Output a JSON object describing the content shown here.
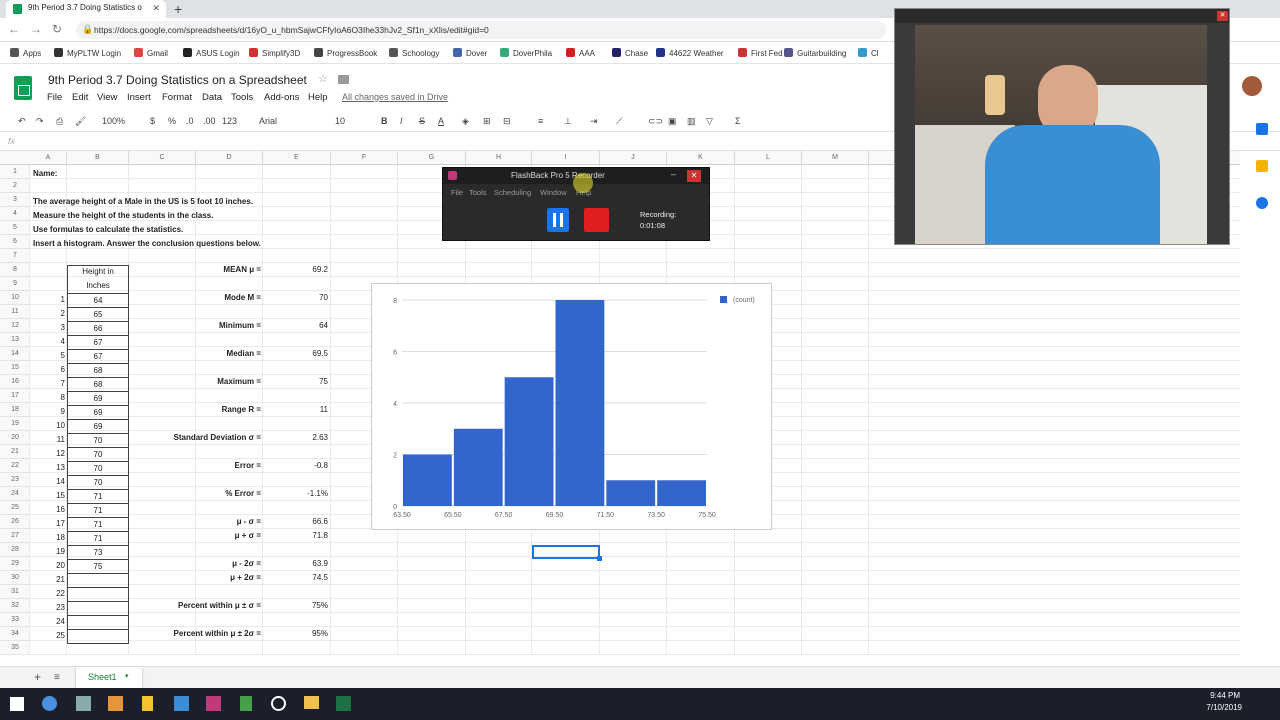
{
  "browser": {
    "tab_title": "9th Period 3.7 Doing Statistics o",
    "url": "https://docs.google.com/spreadsheets/d/16yO_u_hbmSajwCFfyIoA6O3Ihe33hJv2_Sf1n_xXlis/edit#gid=0",
    "bookmarks": [
      "Apps",
      "MyPLTW Login",
      "Gmail",
      "ASUS Login",
      "Simplify3D",
      "ProgressBook",
      "Schoology",
      "Dover",
      "DoverPhila",
      "AAA",
      "Chase",
      "44622 Weather",
      "First Fed",
      "Guitarbuilding",
      "Cl"
    ]
  },
  "doc": {
    "title": "9th Period 3.7 Doing Statistics on a Spreadsheet",
    "menus": [
      "File",
      "Edit",
      "View",
      "Insert",
      "Format",
      "Data",
      "Tools",
      "Add-ons",
      "Help"
    ],
    "saved_status": "All changes saved in Drive"
  },
  "toolbar": {
    "zoom": "100%",
    "currency": "$",
    "percent": "%",
    "dec_less": ".0",
    "dec_more": ".00",
    "format": "123",
    "font": "Arial",
    "size": "10",
    "bold": "B",
    "italic": "I",
    "strike": "S",
    "textcolor": "A",
    "sigma": "Σ"
  },
  "formula_bar": {
    "fx": "fx"
  },
  "columns": [
    "A",
    "B",
    "C",
    "D",
    "E",
    "F",
    "G",
    "H",
    "I",
    "J",
    "K",
    "L",
    "M"
  ],
  "rows": [
    "1",
    "2",
    "3",
    "4",
    "5",
    "6",
    "7",
    "8",
    "9",
    "10",
    "11",
    "12",
    "13",
    "14",
    "15",
    "16",
    "17",
    "18",
    "19",
    "20",
    "21",
    "22",
    "23",
    "24",
    "25",
    "26",
    "27",
    "28",
    "29",
    "30",
    "31",
    "32",
    "33",
    "34",
    "35"
  ],
  "text_cells": {
    "name": "Name:",
    "line1": "The average height of a Male in the US is 5 foot 10 inches.",
    "line2": "Measure the height of the students in the class.",
    "line3": "Use formulas to calculate the statistics.",
    "line4": "Insert a histogram.  Answer the conclusion questions below.",
    "height_header_1": "Height in",
    "height_header_2": "Inches"
  },
  "students": {
    "index": [
      "1",
      "2",
      "3",
      "4",
      "5",
      "6",
      "7",
      "8",
      "9",
      "10",
      "11",
      "12",
      "13",
      "14",
      "15",
      "16",
      "17",
      "18",
      "19",
      "20",
      "21",
      "22",
      "23",
      "24",
      "25"
    ],
    "heights": [
      "64",
      "65",
      "66",
      "67",
      "67",
      "68",
      "68",
      "69",
      "69",
      "69",
      "70",
      "70",
      "70",
      "70",
      "71",
      "71",
      "71",
      "71",
      "73",
      "75",
      "",
      "",
      "",
      "",
      ""
    ]
  },
  "stats": [
    {
      "label": "MEAN μ =",
      "value": "69.2"
    },
    {
      "label": "Mode M =",
      "value": "70"
    },
    {
      "label": "Minimum =",
      "value": "64"
    },
    {
      "label": "Median =",
      "value": "69.5"
    },
    {
      "label": "Maximum =",
      "value": "75"
    },
    {
      "label": "Range R =",
      "value": "11"
    },
    {
      "label": "Standard Deviation σ =",
      "value": "2.63"
    },
    {
      "label": "Error =",
      "value": "-0.8"
    },
    {
      "label": "% Error =",
      "value": "-1.1%"
    },
    {
      "label": "μ - σ =",
      "value": "66.6"
    },
    {
      "label": "μ + σ =",
      "value": "71.8"
    },
    {
      "label": "μ - 2σ =",
      "value": "63.9"
    },
    {
      "label": "μ + 2σ =",
      "value": "74.5"
    },
    {
      "label": "Percent within μ ± σ =",
      "value": "75%"
    },
    {
      "label": "Percent within μ ± 2σ =",
      "value": "95%"
    }
  ],
  "chart_data": {
    "type": "bar",
    "categories": [
      "63.50-65.50",
      "65.50-67.50",
      "67.50-69.50",
      "69.50-71.50",
      "71.50-73.50",
      "73.50-75.50"
    ],
    "x_ticks": [
      "63.50",
      "65.50",
      "67.50",
      "69.50",
      "71.50",
      "73.50",
      "75.50"
    ],
    "values": [
      2,
      3,
      5,
      8,
      1,
      1
    ],
    "series": [
      {
        "name": "(count)",
        "values": [
          2,
          3,
          5,
          8,
          1,
          1
        ]
      }
    ],
    "y_ticks": [
      "0",
      "2",
      "4",
      "6",
      "8"
    ],
    "ylim": [
      0,
      8
    ],
    "bar_color": "#3366cc",
    "legend": "top-right",
    "grid": true
  },
  "recorder": {
    "title": "FlashBack Pro 5 Recorder",
    "menus": [
      "File",
      "Tools",
      "Scheduling",
      "Window",
      "Help"
    ],
    "status_label": "Recording:",
    "elapsed": "0:01:08"
  },
  "sheet_tab": "Sheet1",
  "clock": {
    "time": "9:44 PM",
    "date": "7/10/2019"
  },
  "colors": {
    "sheets_green": "#0f9d58",
    "accent_blue": "#1a73e8",
    "record_red": "#e02020"
  }
}
